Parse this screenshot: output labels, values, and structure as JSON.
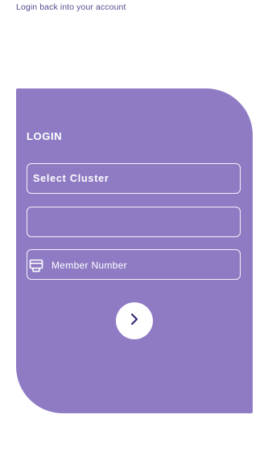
{
  "header": {
    "subtitle": "Login back into your account"
  },
  "login_card": {
    "title": "LOGIN",
    "cluster_field": {
      "value": "Select Cluster"
    },
    "blank_field": {
      "value": ""
    },
    "member_field": {
      "placeholder": "Member Number",
      "icon": "member-card-icon"
    },
    "submit_button": {
      "icon": "chevron-right-icon"
    }
  },
  "colors": {
    "card": "#8e7bc4",
    "subtitle": "#5a4b8f",
    "chevron": "#2d2270",
    "background": "#ffffff"
  }
}
